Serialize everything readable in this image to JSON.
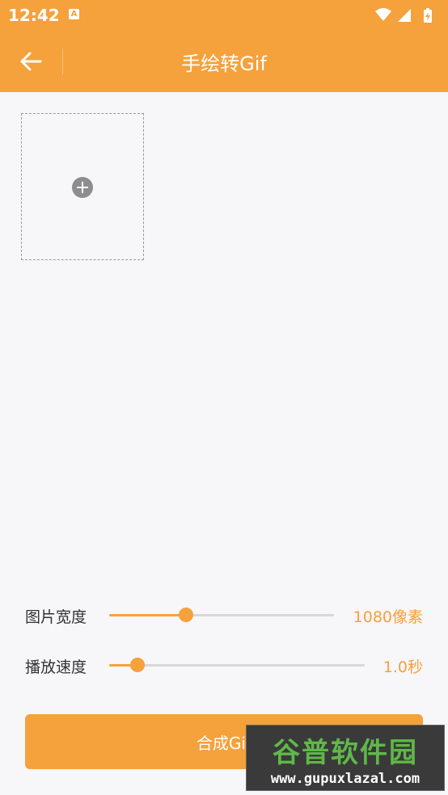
{
  "status_bar": {
    "time": "12:42",
    "notification_icon": "A"
  },
  "toolbar": {
    "title": "手绘转Gif",
    "back_icon": "arrow-left-icon"
  },
  "image_area": {
    "add_icon": "plus-circle-icon"
  },
  "settings": {
    "width": {
      "label": "图片宽度",
      "value": "1080像素",
      "slider_fraction": 0.34
    },
    "speed": {
      "label": "播放速度",
      "value": "1.0秒",
      "slider_fraction": 0.11
    }
  },
  "compose_button": {
    "label": "合成Gif"
  },
  "watermark": {
    "logo": "谷普软件园",
    "url": "www.gupuxlazal.com"
  },
  "colors": {
    "accent": "#f5a13c",
    "background": "#f7f6f9"
  }
}
